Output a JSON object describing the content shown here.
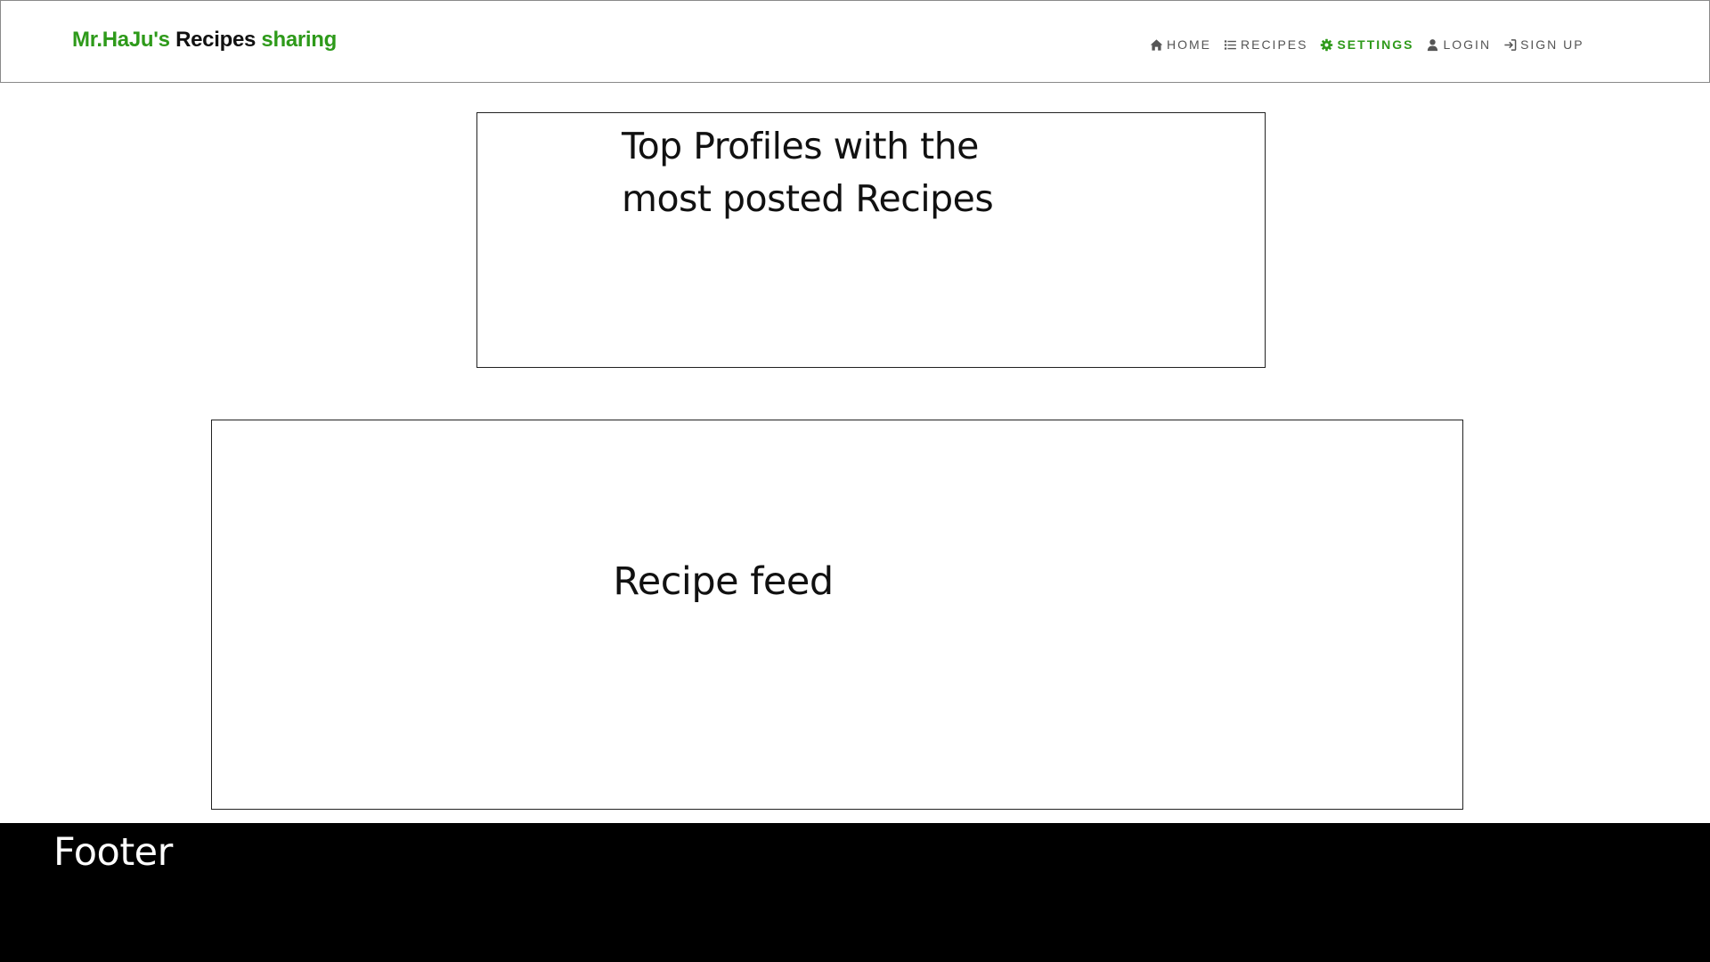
{
  "header": {
    "brand": {
      "part1": "Mr.HaJu's",
      "part2": "Recipes",
      "part3": "sharing"
    },
    "nav": [
      {
        "label": "HOME",
        "icon": "home-icon"
      },
      {
        "label": "RECIPES",
        "icon": "list-icon"
      },
      {
        "label": "SETTINGS",
        "icon": "gear-icon",
        "active": true
      },
      {
        "label": "LOGIN",
        "icon": "user-icon"
      },
      {
        "label": "SIGN UP",
        "icon": "sign-in-icon"
      }
    ]
  },
  "main": {
    "profiles_title": "Top Profiles with the most posted Recipes",
    "feed_title": "Recipe feed"
  },
  "footer": {
    "label": "Footer"
  },
  "colors": {
    "brand_green": "#2e9a1a",
    "nav_text": "#555555",
    "footer_bg": "#000000"
  }
}
